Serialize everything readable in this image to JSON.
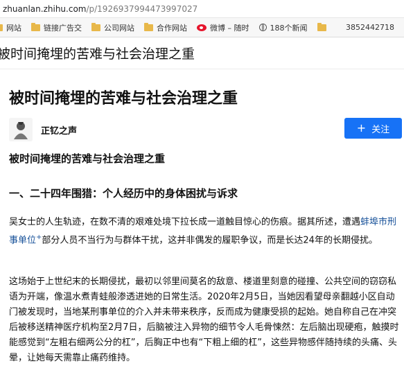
{
  "browser": {
    "url_host": "zhuanlan.zhihu.com",
    "url_path": "/p/1926937994473997027"
  },
  "bookmarks": {
    "items": [
      {
        "label": "网站",
        "icon": "folder-icon"
      },
      {
        "label": "链接广告交",
        "icon": "folder-icon"
      },
      {
        "label": "公司网站",
        "icon": "folder-icon"
      },
      {
        "label": "合作网站",
        "icon": "folder-icon"
      },
      {
        "label": "微博 – 随时",
        "icon": "weibo-icon"
      },
      {
        "label": "188个新闻",
        "icon": "globe-icon"
      },
      {
        "label": "",
        "icon": "folder-icon"
      }
    ],
    "right_text": "3852442718"
  },
  "sticky_title": "被时间掩埋的苦难与社会治理之重",
  "article": {
    "title": "被时间掩埋的苦难与社会治理之重",
    "author": "正钇之声",
    "follow_label": "关注",
    "subtitle": "被时间掩埋的苦难与社会治理之重",
    "section_heading": "一、二十四年围猎：个人经历中的身体困扰与诉求",
    "p1_before": "吴女士的人生轨迹，在数不清的艰难处境下拉长成一道触目惊心的伤痕。据其所述，遭遇",
    "p1_link": "蚌埠市刑事单位",
    "p1_mark": "+",
    "p1_after": "部分人员不当行为与群体干扰，这并非偶发的履职争议，而是长达24年的长期侵扰。",
    "p2": "这场始于上世纪末的长期侵扰，最初以邻里间莫名的敌意、楼道里刻意的碰撞、公共空间的窃窃私语为开端，像温水煮青蛙般渗透进她的日常生活。2020年2月5日，当她因看望母亲翻越小区自动门被发现时，当地某刑事单位的介入并未带来秩序，反而成为健康受损的起始。她自称自己在冲突后被移送精神医疗机构至2月7日，后脑被注入异物的细节令人毛骨悚然：左后脑出现硬疱，触摸时能感觉到“左粗右细两公分的杠”，后胸正中也有“下粗上细的杠”，这些异物感伴随持续的头痛、头晕，让她每天需靠止痛药维持。"
  }
}
